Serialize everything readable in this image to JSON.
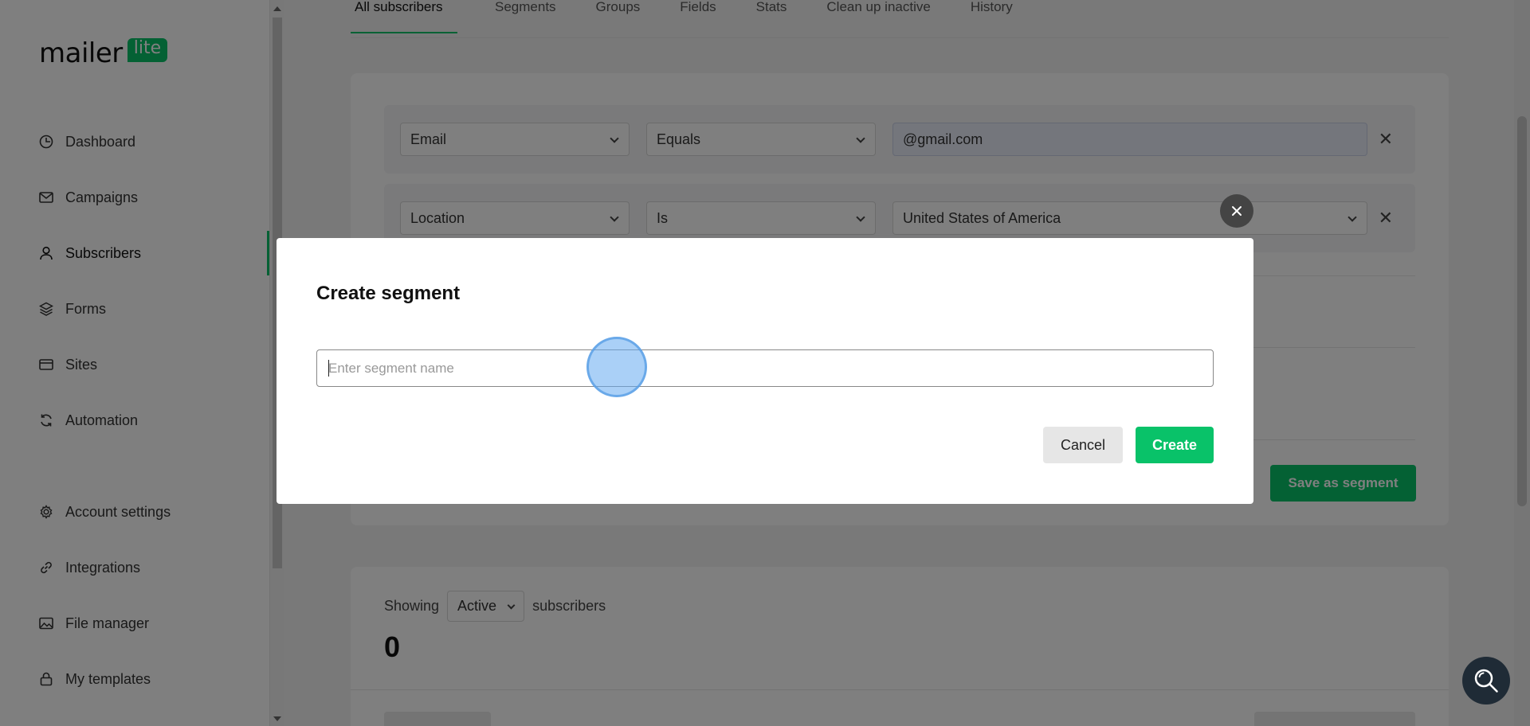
{
  "brand": {
    "logo_main": "mailer",
    "logo_badge": "lite",
    "accent_color": "#09c269"
  },
  "sidebar": {
    "items": [
      {
        "label": "Dashboard",
        "icon": "clock-icon"
      },
      {
        "label": "Campaigns",
        "icon": "mail-icon"
      },
      {
        "label": "Subscribers",
        "icon": "user-icon",
        "active": true
      },
      {
        "label": "Forms",
        "icon": "layers-icon"
      },
      {
        "label": "Sites",
        "icon": "browser-icon"
      },
      {
        "label": "Automation",
        "icon": "refresh-icon"
      },
      {
        "label": "Account settings",
        "icon": "gear-icon"
      },
      {
        "label": "Integrations",
        "icon": "link-icon"
      },
      {
        "label": "File manager",
        "icon": "image-icon"
      },
      {
        "label": "My templates",
        "icon": "lock-icon"
      }
    ]
  },
  "tabs": [
    {
      "label": "All subscribers",
      "active": true
    },
    {
      "label": "Segments"
    },
    {
      "label": "Groups"
    },
    {
      "label": "Fields"
    },
    {
      "label": "Stats"
    },
    {
      "label": "Clean up inactive"
    },
    {
      "label": "History"
    }
  ],
  "filters": [
    {
      "field": "Email",
      "operator": "Equals",
      "value": "@gmail.com"
    },
    {
      "field": "Location",
      "operator": "Is",
      "value": "United States of America"
    }
  ],
  "save_segment_label": "Save as segment",
  "subscribers": {
    "showing_label": "Showing",
    "status": "Active",
    "suffix": "subscribers",
    "count": "0"
  },
  "modal": {
    "title": "Create segment",
    "input_placeholder": "Enter segment name",
    "input_value": "",
    "cancel_label": "Cancel",
    "create_label": "Create"
  }
}
